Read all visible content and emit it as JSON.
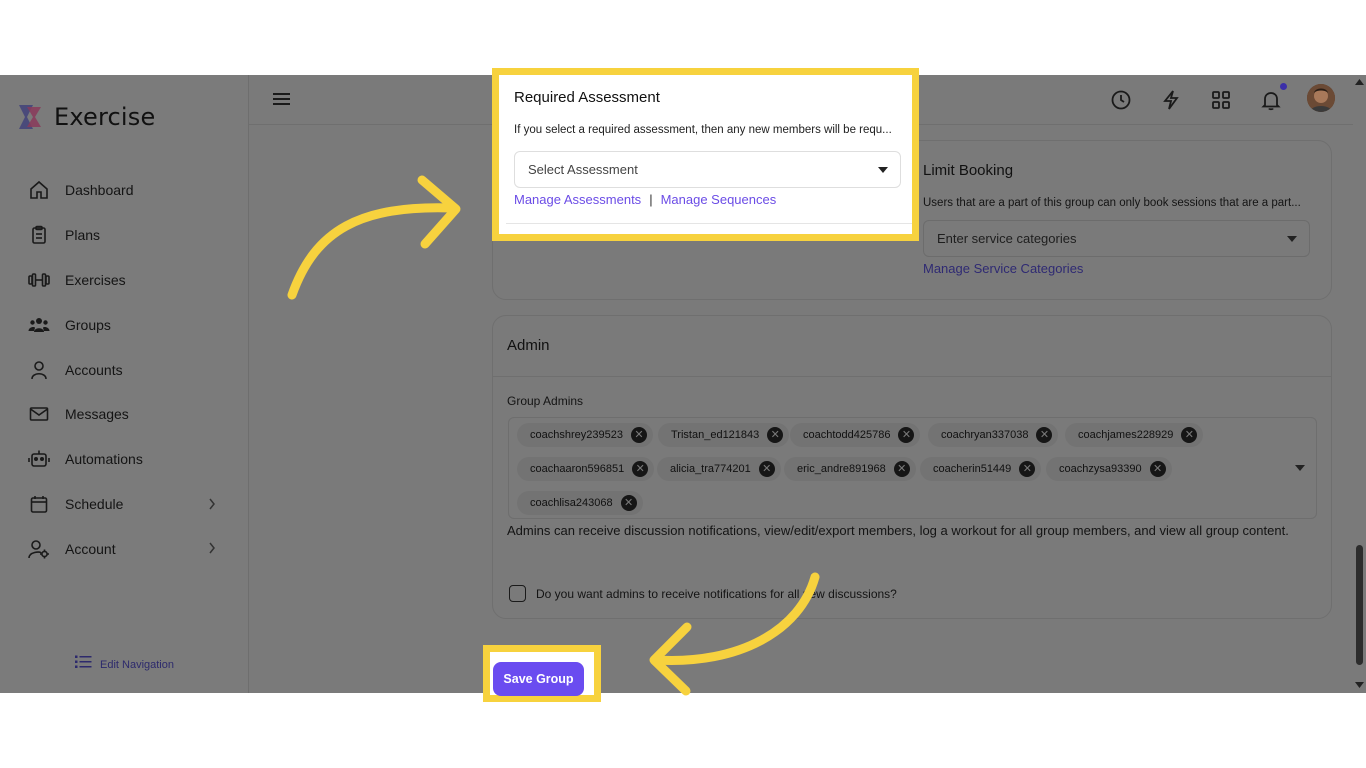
{
  "app": {
    "name": "Exercise"
  },
  "sidebar": {
    "items": [
      {
        "label": "Dashboard",
        "icon": "home-icon"
      },
      {
        "label": "Plans",
        "icon": "clipboard-icon"
      },
      {
        "label": "Exercises",
        "icon": "dumbbell-icon"
      },
      {
        "label": "Groups",
        "icon": "users-icon"
      },
      {
        "label": "Accounts",
        "icon": "user-icon"
      },
      {
        "label": "Messages",
        "icon": "mail-icon"
      },
      {
        "label": "Automations",
        "icon": "robot-icon"
      },
      {
        "label": "Schedule",
        "icon": "calendar-icon"
      },
      {
        "label": "Account",
        "icon": "user-settings-icon"
      }
    ],
    "edit_navigation": "Edit Navigation"
  },
  "header": {
    "icons": [
      "menu-icon",
      "clock-icon",
      "bolt-icon",
      "grid-icon",
      "bell-icon",
      "avatar"
    ]
  },
  "required_assessment": {
    "title": "Required Assessment",
    "help": "If you select a required assessment, then any new members will be requ...",
    "select_placeholder": "Select Assessment",
    "link_assessments": "Manage Assessments",
    "separator": "|",
    "link_sequences": "Manage Sequences"
  },
  "limit_booking": {
    "title": "Limit Booking",
    "help": "Users that are a part of this group can only book sessions that are a part...",
    "select_placeholder": "Enter service categories",
    "link": "Manage Service Categories"
  },
  "admin": {
    "title": "Admin",
    "group_admins_label": "Group Admins",
    "admins": [
      "coachshrey239523",
      "Tristan_ed121843",
      "coachtodd425786",
      "coachryan337038",
      "coachjames228929",
      "coachaaron596851",
      "alicia_tra774201",
      "eric_andre891968",
      "coacherin51449",
      "coachzysa93390",
      "coachlisa243068"
    ],
    "description": "Admins can receive discussion notifications, view/edit/export members, log a workout for all group members, and view all group content.",
    "checkbox_label": "Do you want admins to receive notifications for all new discussions?"
  },
  "save_button": "Save Group",
  "colors": {
    "accent": "#6a4cf0",
    "highlight": "#f7d23e",
    "arrow": "#f7d23e",
    "overlay": "#7a7a7a"
  }
}
